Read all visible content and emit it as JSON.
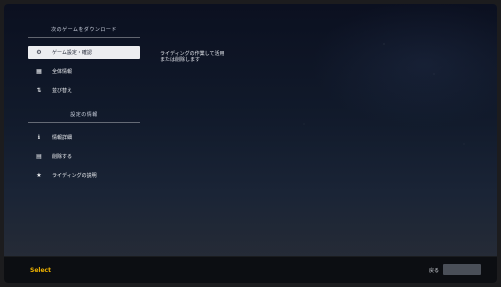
{
  "menu": {
    "section1_title": "次のゲームをダウンロード",
    "section2_title": "設定の情報",
    "items": [
      {
        "label": "ゲーム設定・確認",
        "icon": "gear-icon",
        "glyph": "⚙"
      },
      {
        "label": "全体情報",
        "icon": "grid-icon",
        "glyph": "▦"
      },
      {
        "label": "並び替え",
        "icon": "sort-icon",
        "glyph": "⇅"
      },
      {
        "label": "情報詳細",
        "icon": "info-icon",
        "glyph": "ℹ"
      },
      {
        "label": "削除する",
        "icon": "delete-icon",
        "glyph": "▤"
      },
      {
        "label": "ライディングの説明",
        "icon": "star-icon",
        "glyph": "★"
      }
    ]
  },
  "description": "ライディングの作業して活用\nまたは削除します",
  "bottom_bar": {
    "brand": "Select",
    "hint": "戻る"
  }
}
